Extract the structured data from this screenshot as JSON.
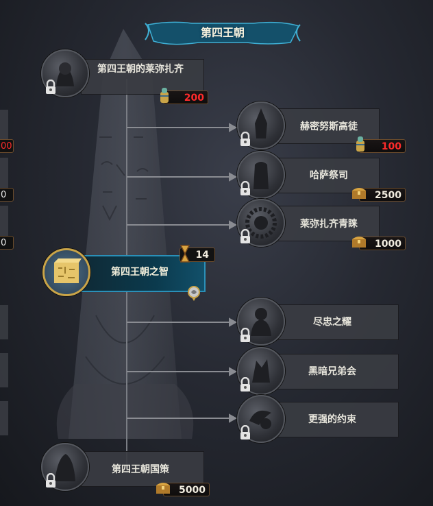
{
  "header": {
    "title": "第四王朝"
  },
  "colors": {
    "accent_teal": "#1a6d8a",
    "cost_red": "#ff2b2b",
    "cost_white": "#f2ede0",
    "gold": "#c9a448"
  },
  "selected": {
    "label": "第四王朝之智",
    "timer_value": "14",
    "timer_icon": "hourglass-icon",
    "badge_icon": "snake-emblem-icon"
  },
  "nodes": [
    {
      "label": "第四王朝的莱弥扎齐",
      "cost": "200",
      "cost_icon": "canopic-jar-icon",
      "cost_style": "red",
      "locked": true
    },
    {
      "label": "赫密努斯高徒",
      "cost": "100",
      "cost_icon": "canopic-jar-icon",
      "cost_style": "red",
      "locked": true
    },
    {
      "label": "哈萨祭司",
      "cost": "2500",
      "cost_icon": "treasure-chest-icon",
      "cost_style": "white",
      "locked": true
    },
    {
      "label": "莱弥扎齐青睐",
      "cost": "1000",
      "cost_icon": "treasure-chest-icon",
      "cost_style": "white",
      "locked": true
    },
    {
      "label": "尽忠之耀",
      "locked": true
    },
    {
      "label": "黑暗兄弟会",
      "locked": true
    },
    {
      "label": "更强的约束",
      "locked": true
    },
    {
      "label": "第四王朝国策",
      "cost": "5000",
      "cost_icon": "treasure-chest-icon",
      "cost_style": "white",
      "locked": true
    }
  ],
  "left_edge_costs": [
    {
      "text": "00",
      "style": "red"
    },
    {
      "text": "0",
      "style": "white"
    },
    {
      "text": "0",
      "style": "white"
    }
  ]
}
